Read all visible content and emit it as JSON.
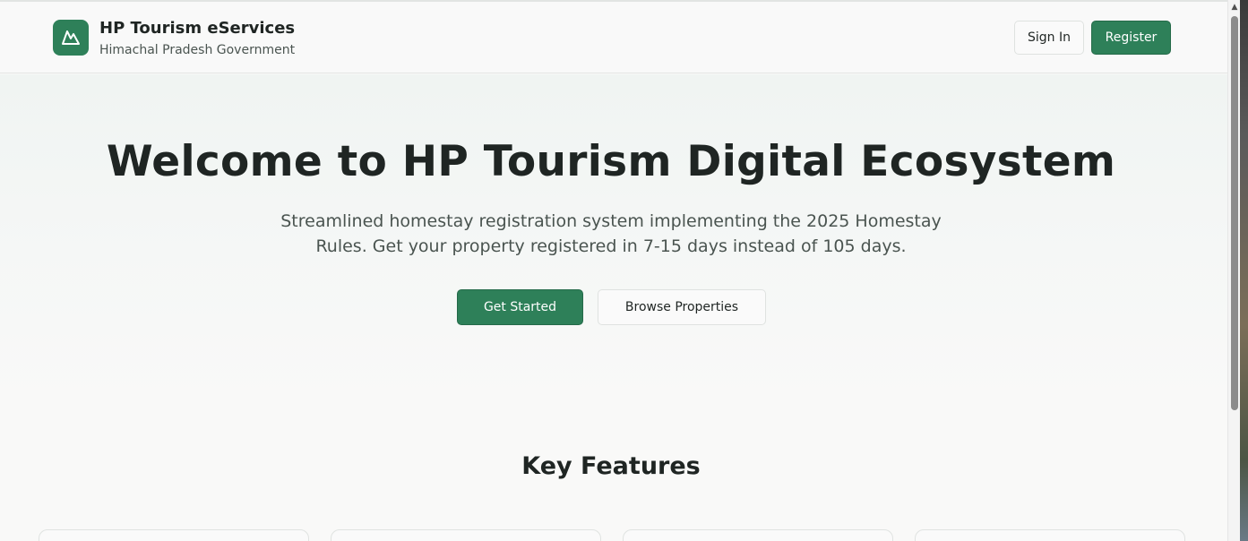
{
  "header": {
    "title": "HP Tourism eServices",
    "subtitle": "Himachal Pradesh Government",
    "logo_icon": "mountain-icon",
    "sign_in_label": "Sign In",
    "register_label": "Register"
  },
  "hero": {
    "title": "Welcome to HP Tourism Digital Ecosystem",
    "description": "Streamlined homestay registration system implementing the 2025 Homestay Rules. Get your property registered in 7-15 days instead of 105 days.",
    "primary_cta": "Get Started",
    "secondary_cta": "Browse Properties"
  },
  "features": {
    "title": "Key Features"
  },
  "colors": {
    "brand_green": "#2e8059",
    "text_dark": "#1f2523",
    "text_muted": "#4a5450",
    "background": "#f9f9f8"
  }
}
